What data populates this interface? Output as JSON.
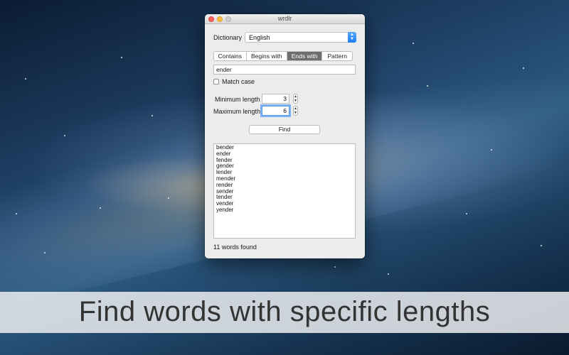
{
  "window": {
    "title": "wrdlr"
  },
  "dictionary": {
    "label": "Dictionary",
    "value": "English"
  },
  "tabs": [
    {
      "label": "Contains",
      "active": false
    },
    {
      "label": "Begins with",
      "active": false
    },
    {
      "label": "Ends with",
      "active": true
    },
    {
      "label": "Pattern",
      "active": false
    }
  ],
  "search": {
    "value": "ender"
  },
  "match_case": {
    "label": "Match case",
    "checked": false
  },
  "min_length": {
    "label": "Minimum length",
    "value": "3"
  },
  "max_length": {
    "label": "Maximum length",
    "value": "6"
  },
  "find_button": {
    "label": "Find"
  },
  "results": [
    "bender",
    "ender",
    "fender",
    "gender",
    "lender",
    "mender",
    "render",
    "sender",
    "tender",
    "vender",
    "yender"
  ],
  "status": {
    "text": "11 words found"
  },
  "caption": {
    "text": "Find words with specific lengths"
  },
  "colors": {
    "accent": "#1c7ff0",
    "active_segment": "#6d6d6d"
  }
}
